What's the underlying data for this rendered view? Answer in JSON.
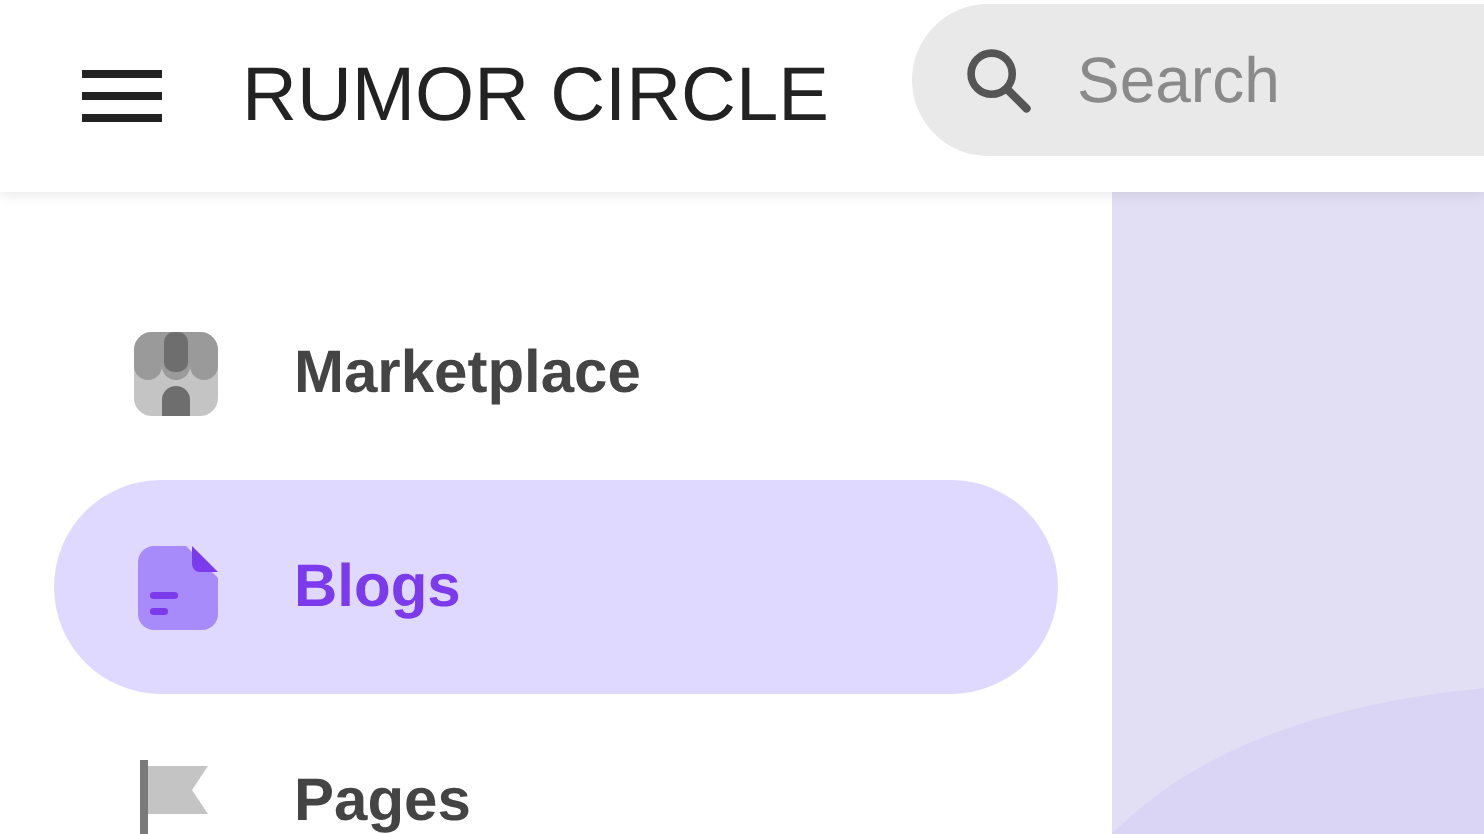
{
  "header": {
    "title": "RUMOR CIRCLE",
    "search": {
      "placeholder": "Search"
    }
  },
  "sidebar": {
    "items": [
      {
        "label": "Marketplace",
        "kind": "store",
        "selected": false
      },
      {
        "label": "Blogs",
        "kind": "document",
        "selected": true
      },
      {
        "label": "Pages",
        "kind": "flag",
        "selected": false
      }
    ]
  }
}
